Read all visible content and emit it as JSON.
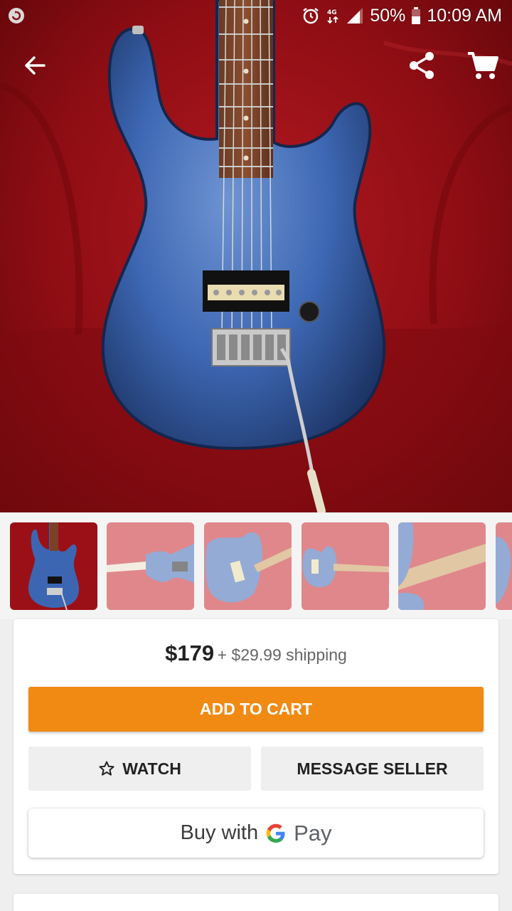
{
  "status_bar": {
    "battery": "50%",
    "time": "10:09 AM",
    "icons": [
      "app-notification-icon",
      "alarm-icon",
      "data-4g-icon",
      "signal-icon",
      "battery-icon"
    ]
  },
  "app_bar": {
    "icons": [
      "back-arrow-icon",
      "share-icon",
      "cart-icon"
    ]
  },
  "gallery": {
    "thumbnail_count": 6,
    "selected_index": 0
  },
  "listing": {
    "price": "$179",
    "shipping": "+ $29.99 shipping"
  },
  "actions": {
    "add_to_cart": "ADD TO CART",
    "watch": "WATCH",
    "message_seller": "MESSAGE SELLER",
    "buy_with": "Buy with",
    "pay": "Pay"
  },
  "colors": {
    "accent": "#f18a13",
    "background": "#efefef",
    "hero_backdrop": "#a01018",
    "guitar_blue": "#3a66b0"
  }
}
